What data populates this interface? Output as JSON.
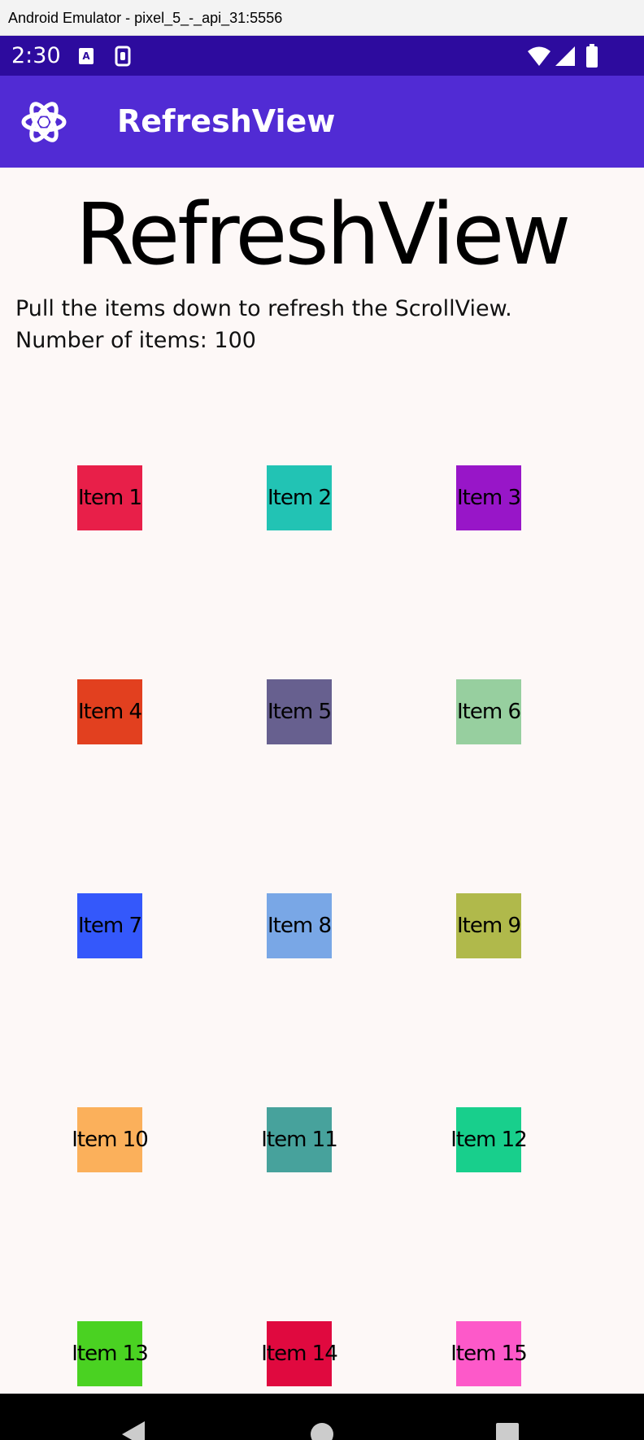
{
  "window": {
    "title": "Android Emulator - pixel_5_-_api_31:5556"
  },
  "status_bar": {
    "time": "2:30",
    "icons": [
      "text-a-icon",
      "sim-icon",
      "wifi-icon",
      "signal-icon",
      "battery-icon"
    ],
    "background": "#2d0b9e"
  },
  "app_bar": {
    "title": "RefreshView",
    "icon": "dotnet-bot-atom-icon",
    "background": "#512bd4"
  },
  "page": {
    "heading": "RefreshView",
    "description": "Pull the items down to refresh the ScrollView.",
    "item_count_label": "Number of items: 100"
  },
  "items": [
    {
      "label": "Item 1",
      "color": "#e81f49"
    },
    {
      "label": "Item 2",
      "color": "#22c3b4"
    },
    {
      "label": "Item 3",
      "color": "#9816c8"
    },
    {
      "label": "Item 4",
      "color": "#e2401f"
    },
    {
      "label": "Item 5",
      "color": "#67608f"
    },
    {
      "label": "Item 6",
      "color": "#97cf9f"
    },
    {
      "label": "Item 7",
      "color": "#3458fb"
    },
    {
      "label": "Item 8",
      "color": "#79a7e6"
    },
    {
      "label": "Item 9",
      "color": "#b0b94b"
    },
    {
      "label": "Item 10",
      "color": "#fbb05b"
    },
    {
      "label": "Item 11",
      "color": "#47a29c"
    },
    {
      "label": "Item 12",
      "color": "#18cf8c"
    },
    {
      "label": "Item 13",
      "color": "#4ad222"
    },
    {
      "label": "Item 14",
      "color": "#e0093f"
    },
    {
      "label": "Item 15",
      "color": "#fd59c9"
    }
  ],
  "nav_bar": {
    "buttons": [
      "back-icon",
      "home-icon",
      "recents-icon"
    ]
  }
}
